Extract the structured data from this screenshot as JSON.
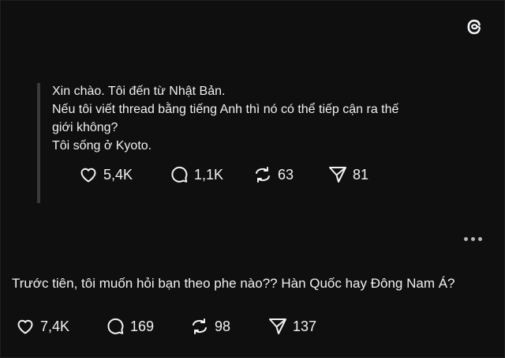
{
  "quoted_post": {
    "lines": [
      "Xin chào. Tôi đến từ Nhật Bản.",
      "Nếu tôi viết thread bằng tiếng Anh thì nó có thể tiếp cận ra thế",
      "giới không?",
      "Tôi sống ở Kyoto."
    ],
    "likes": "5,4K",
    "replies": "1,1K",
    "reposts": "63",
    "shares": "81"
  },
  "reply_post": {
    "text": "Trước tiên, tôi muốn hỏi bạn theo phe nào?? Hàn Quốc hay Đông Nam Á?",
    "likes": "7,4K",
    "replies": "169",
    "reposts": "98",
    "shares": "137"
  },
  "icons": {
    "logo": "threads-logo-icon",
    "like": "heart-icon",
    "reply": "comment-icon",
    "repost": "repost-icon",
    "share": "send-icon",
    "more": "more-options-icon"
  },
  "colors": {
    "background": "#0f0f0f",
    "text": "#f1f1f1",
    "quote_bar": "#3a3a3a"
  }
}
